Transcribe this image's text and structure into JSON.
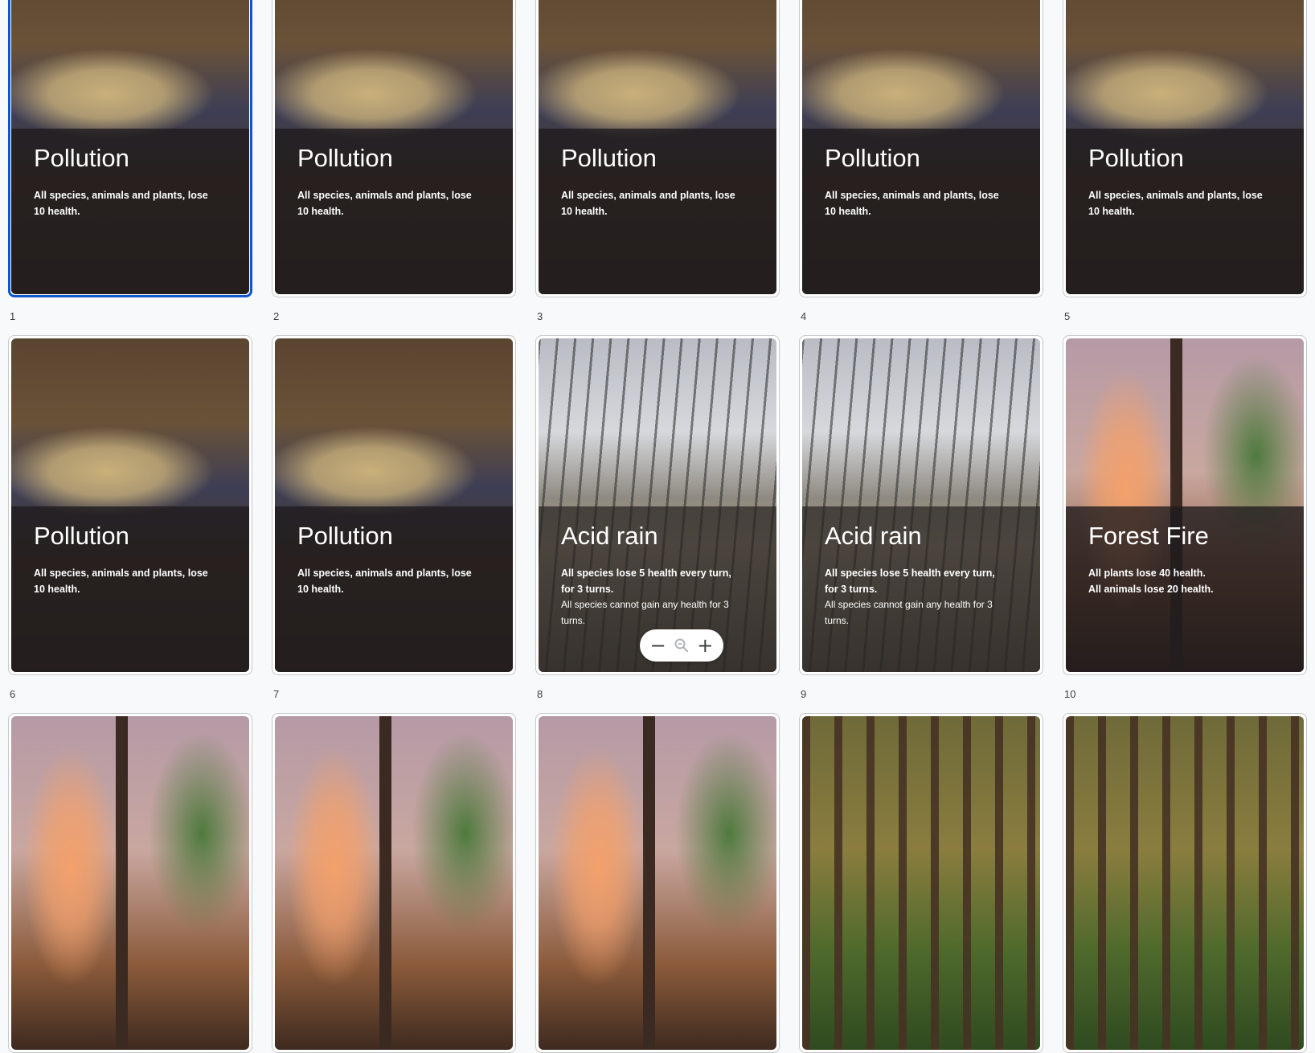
{
  "slides": [
    {
      "number": "1",
      "title": "Pollution",
      "lines": [
        "All species, animals and plants, lose 10 health."
      ],
      "sub": [],
      "image": "pollution",
      "selected": true
    },
    {
      "number": "2",
      "title": "Pollution",
      "lines": [
        "All species, animals and plants, lose 10 health."
      ],
      "sub": [],
      "image": "pollution"
    },
    {
      "number": "3",
      "title": "Pollution",
      "lines": [
        "All species, animals and plants, lose 10 health."
      ],
      "sub": [],
      "image": "pollution"
    },
    {
      "number": "4",
      "title": "Pollution",
      "lines": [
        "All species, animals and plants, lose 10 health."
      ],
      "sub": [],
      "image": "pollution"
    },
    {
      "number": "5",
      "title": "Pollution",
      "lines": [
        "All species, animals and plants, lose 10 health."
      ],
      "sub": [],
      "image": "pollution"
    },
    {
      "number": "6",
      "title": "Pollution",
      "lines": [
        "All species, animals and plants, lose 10 health."
      ],
      "sub": [],
      "image": "pollution"
    },
    {
      "number": "7",
      "title": "Pollution",
      "lines": [
        "All species, animals and plants, lose 10 health."
      ],
      "sub": [],
      "image": "pollution"
    },
    {
      "number": "8",
      "title": "Acid rain",
      "lines": [
        "All species lose 5 health every turn, for 3 turns."
      ],
      "sub": [
        "All species cannot gain any health for 3 turns."
      ],
      "image": "acid"
    },
    {
      "number": "9",
      "title": "Acid rain",
      "lines": [
        "All species lose 5 health every turn, for 3 turns."
      ],
      "sub": [
        "All species cannot gain any health for 3 turns."
      ],
      "image": "acid"
    },
    {
      "number": "10",
      "title": "Forest Fire",
      "lines": [
        "All plants lose 40 health.",
        "All animals lose 20 health."
      ],
      "sub": [],
      "image": "fire"
    },
    {
      "number": "",
      "title": "",
      "lines": [],
      "sub": [],
      "image": "fire"
    },
    {
      "number": "",
      "title": "",
      "lines": [],
      "sub": [],
      "image": "fire"
    },
    {
      "number": "",
      "title": "",
      "lines": [],
      "sub": [],
      "image": "fire"
    },
    {
      "number": "",
      "title": "",
      "lines": [],
      "sub": [],
      "image": "forest"
    },
    {
      "number": "",
      "title": "",
      "lines": [],
      "sub": [],
      "image": "forest"
    }
  ],
  "zoom_controls": {
    "zoom_out_icon": "minus-icon",
    "zoom_icon": "magnifier-icon",
    "zoom_in_icon": "plus-icon"
  },
  "colors": {
    "selection": "#0b57d0",
    "background": "#f8f9fb"
  }
}
